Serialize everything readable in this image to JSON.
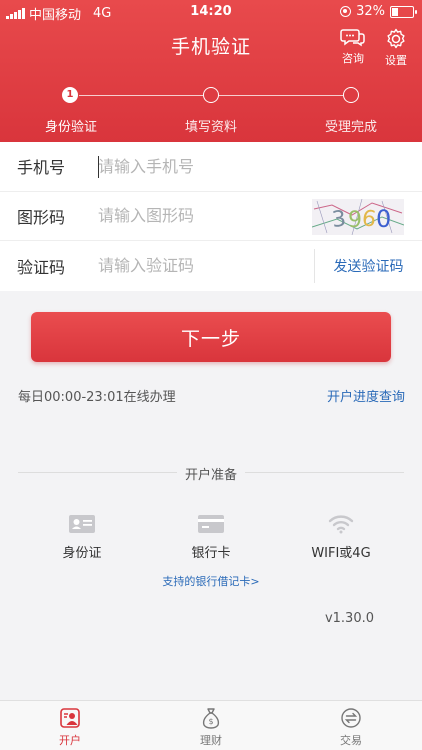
{
  "status_bar": {
    "carrier": "中国移动",
    "network": "4G",
    "time": "14:20",
    "battery": "32%",
    "battery_level": 0.32
  },
  "header": {
    "title": "手机验证",
    "consult_label": "咨询",
    "settings_label": "设置"
  },
  "steps": [
    {
      "number": "1",
      "label": "身份验证",
      "active": true
    },
    {
      "number": "",
      "label": "填写资料",
      "active": false
    },
    {
      "number": "",
      "label": "受理完成",
      "active": false
    }
  ],
  "form": {
    "phone": {
      "label": "手机号",
      "placeholder": "请输入手机号",
      "value": ""
    },
    "captcha": {
      "label": "图形码",
      "placeholder": "请输入图形码",
      "image_text": "3960"
    },
    "code": {
      "label": "验证码",
      "placeholder": "请输入验证码",
      "send_label": "发送验证码"
    }
  },
  "next_button": "下一步",
  "service_hours": "每日00:00-23:01在线办理",
  "progress_link": "开户进度查询",
  "preparation": {
    "title": "开户准备",
    "items": [
      {
        "icon": "id-card-icon",
        "label": "身份证"
      },
      {
        "icon": "bank-card-icon",
        "label": "银行卡"
      },
      {
        "icon": "wifi-icon",
        "label": "WIFI或4G"
      }
    ],
    "support_link": "支持的银行借记卡>"
  },
  "version": "v1.30.0",
  "tabbar": [
    {
      "icon": "open-account-icon",
      "label": "开户",
      "active": true
    },
    {
      "icon": "money-bag-icon",
      "label": "理财",
      "active": false
    },
    {
      "icon": "exchange-icon",
      "label": "交易",
      "active": false
    }
  ],
  "colors": {
    "brand_red": "#d9353c",
    "link_blue": "#2a6ab8"
  }
}
